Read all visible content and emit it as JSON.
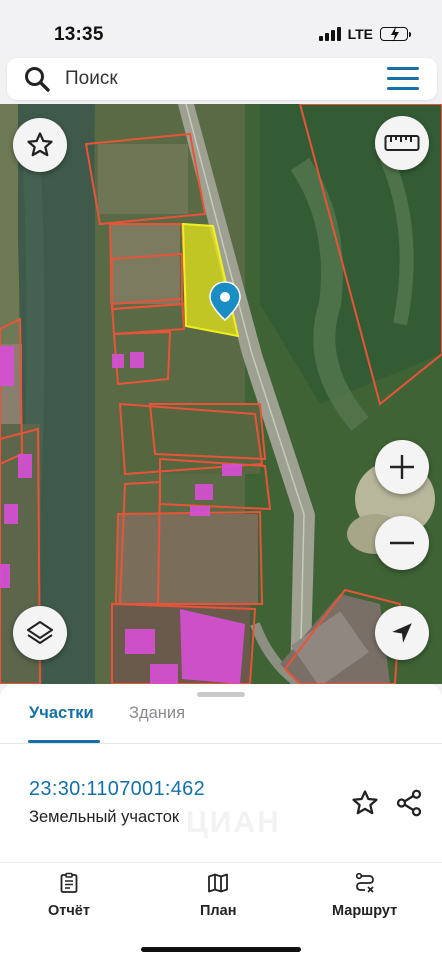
{
  "status_bar": {
    "time": "13:35",
    "network": "LTE",
    "battery_charging": true
  },
  "search": {
    "placeholder": "Поиск",
    "icon": "search-icon",
    "menu_icon": "hamburger-menu-icon"
  },
  "map": {
    "highlight_color": "#e5e61a",
    "boundary_color": "#e8543a",
    "building_color": "#d94fd6",
    "controls": {
      "favorite": "star-icon",
      "ruler": "ruler-icon",
      "zoom_in": "plus-icon",
      "zoom_out": "minus-icon",
      "layers": "layers-icon",
      "locate": "navigation-arrow-icon"
    }
  },
  "sheet": {
    "tabs": [
      {
        "label": "Участки",
        "active": true
      },
      {
        "label": "Здания",
        "active": false
      }
    ],
    "parcel": {
      "number": "23:30:1107001:462",
      "type": "Земельный участок"
    },
    "watermark": "ЦИАН"
  },
  "bottom_nav": {
    "items": [
      {
        "label": "Отчёт",
        "icon": "report-clipboard-icon"
      },
      {
        "label": "План",
        "icon": "map-plan-icon"
      },
      {
        "label": "Маршрут",
        "icon": "route-icon"
      }
    ]
  },
  "colors": {
    "accent": "#1670a8",
    "inactive_tab": "#8a8a8e"
  }
}
